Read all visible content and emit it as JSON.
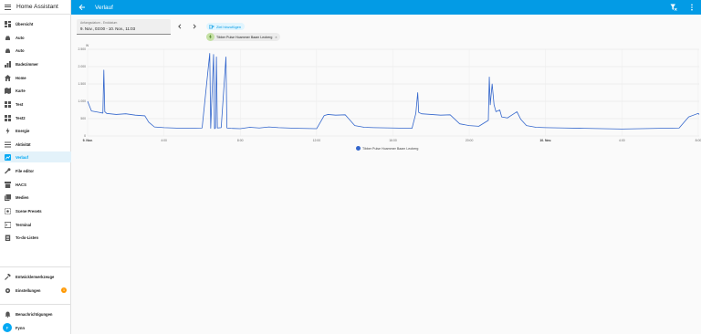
{
  "sidebar": {
    "title": "Home Assistant",
    "items": [
      {
        "label": "Übersicht",
        "icon": "dashboard-icon"
      },
      {
        "label": "Auto",
        "icon": "car-icon"
      },
      {
        "label": "Auto",
        "icon": "car-icon"
      },
      {
        "label": "Badezimmer",
        "icon": "chart-icon"
      },
      {
        "label": "Home",
        "icon": "home-icon"
      },
      {
        "label": "Karte",
        "icon": "map-icon"
      },
      {
        "label": "Test",
        "icon": "grid-icon"
      },
      {
        "label": "Test2",
        "icon": "grid-icon"
      },
      {
        "label": "Energie",
        "icon": "lightning-icon"
      },
      {
        "label": "Aktivität",
        "icon": "list-icon"
      },
      {
        "label": "Verlauf",
        "icon": "chart-box-icon"
      },
      {
        "label": "File editor",
        "icon": "wrench-icon"
      },
      {
        "label": "HACS",
        "icon": "store-icon"
      },
      {
        "label": "Medien",
        "icon": "media-icon"
      },
      {
        "label": "Scene Presets",
        "icon": "scene-icon"
      },
      {
        "label": "Terminal",
        "icon": "console-icon"
      },
      {
        "label": "To-do-Listen",
        "icon": "clipboard-icon"
      }
    ],
    "bottom": {
      "dev_tools": "Entwicklerwerkzeuge",
      "settings": "Einstellungen",
      "settings_badge": "1",
      "notifications": "Benachrichtigungen",
      "user": "Fynn",
      "user_initial": "F"
    }
  },
  "topbar": {
    "title": "Verlauf"
  },
  "controls": {
    "date_label": "Anfangsdatum - Enddatum",
    "date_value": "9. Nov., 03:00 - 10. Nov., 11:03",
    "add_target": "Ziel hinzufügen",
    "chip_label": "Tibber Pulse Hoammer Baam Leoberg"
  },
  "chart_data": {
    "type": "line",
    "unit": "W",
    "y_ticks": [
      "2.500",
      "2.000",
      "1.500",
      "1.000",
      "500",
      "0"
    ],
    "ylim": [
      0,
      2500
    ],
    "x_ticks": [
      "9. Nov.",
      "4:00",
      "8:00",
      "12:00",
      "16:00",
      "20:00",
      "10. Nov.",
      "4:00",
      "8:00"
    ],
    "xlim_hours": [
      0,
      32.05
    ],
    "legend_placement": "bottom",
    "series": [
      {
        "name": "Tibber Pulse Hoammer Baam Leoberg",
        "color": "#3366cc",
        "points": [
          [
            0,
            1000
          ],
          [
            0.2,
            720
          ],
          [
            0.4,
            700
          ],
          [
            0.6,
            680
          ],
          [
            0.8,
            660
          ],
          [
            0.85,
            1900
          ],
          [
            0.9,
            700
          ],
          [
            1.0,
            650
          ],
          [
            1.5,
            620
          ],
          [
            2.0,
            640
          ],
          [
            2.5,
            600
          ],
          [
            3.0,
            580
          ],
          [
            3.2,
            400
          ],
          [
            3.5,
            260
          ],
          [
            4.0,
            240
          ],
          [
            5.0,
            220
          ],
          [
            6.0,
            230
          ],
          [
            6.4,
            2380
          ],
          [
            6.45,
            220
          ],
          [
            6.6,
            2350
          ],
          [
            6.65,
            210
          ],
          [
            6.7,
            230
          ],
          [
            6.75,
            2280
          ],
          [
            6.8,
            230
          ],
          [
            7.0,
            240
          ],
          [
            7.25,
            2280
          ],
          [
            7.3,
            230
          ],
          [
            7.5,
            220
          ],
          [
            8.0,
            210
          ],
          [
            8.5,
            250
          ],
          [
            9.0,
            230
          ],
          [
            9.5,
            260
          ],
          [
            10.0,
            240
          ],
          [
            11.0,
            220
          ],
          [
            12.0,
            210
          ],
          [
            12.4,
            590
          ],
          [
            12.6,
            620
          ],
          [
            13.0,
            600
          ],
          [
            13.5,
            610
          ],
          [
            14.0,
            300
          ],
          [
            14.5,
            250
          ],
          [
            15.0,
            240
          ],
          [
            16.0,
            230
          ],
          [
            17.0,
            220
          ],
          [
            17.2,
            650
          ],
          [
            17.3,
            1250
          ],
          [
            17.35,
            680
          ],
          [
            17.5,
            640
          ],
          [
            18.0,
            620
          ],
          [
            18.5,
            600
          ],
          [
            19.0,
            610
          ],
          [
            19.5,
            350
          ],
          [
            20.0,
            300
          ],
          [
            20.5,
            280
          ],
          [
            21.0,
            450
          ],
          [
            21.05,
            1700
          ],
          [
            21.1,
            900
          ],
          [
            21.2,
            1500
          ],
          [
            21.3,
            900
          ],
          [
            21.4,
            700
          ],
          [
            21.6,
            750
          ],
          [
            21.7,
            550
          ],
          [
            22.0,
            520
          ],
          [
            22.5,
            700
          ],
          [
            22.7,
            480
          ],
          [
            23.0,
            300
          ],
          [
            23.5,
            250
          ],
          [
            24.0,
            240
          ],
          [
            25.0,
            230
          ],
          [
            26.0,
            220
          ],
          [
            27.0,
            210
          ],
          [
            28.0,
            200
          ],
          [
            29.0,
            210
          ],
          [
            30.0,
            220
          ],
          [
            31.0,
            230
          ],
          [
            31.5,
            550
          ],
          [
            32.0,
            650
          ],
          [
            32.05,
            620
          ]
        ]
      }
    ]
  }
}
